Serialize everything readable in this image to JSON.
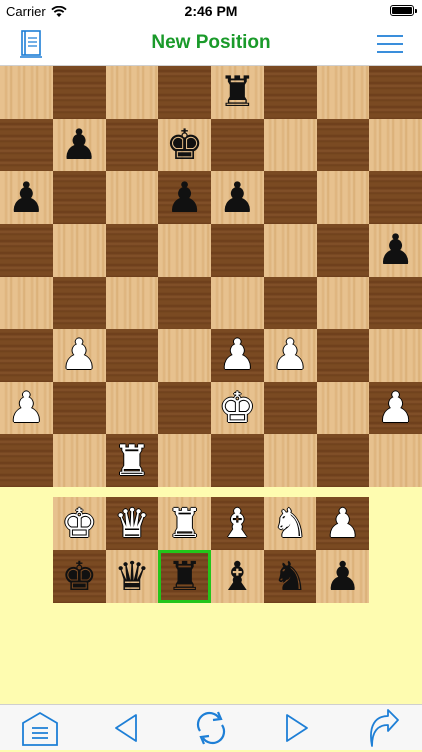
{
  "status_bar": {
    "carrier": "Carrier",
    "time": "2:46 PM"
  },
  "nav": {
    "title": "New Position",
    "title_color": "#1a9a2a",
    "accent": "#1e7fd6",
    "left_icon": "book-icon",
    "right_icon": "menu-icon"
  },
  "board": {
    "squares": [
      [
        "",
        "",
        "",
        "",
        "br",
        "",
        "",
        ""
      ],
      [
        "",
        "bp",
        "",
        "bk",
        "",
        "",
        "",
        ""
      ],
      [
        "bp",
        "",
        "",
        "bp",
        "bp",
        "",
        "",
        ""
      ],
      [
        "",
        "",
        "",
        "",
        "",
        "",
        "",
        "bp"
      ],
      [
        "",
        "",
        "",
        "",
        "",
        "",
        "",
        ""
      ],
      [
        "",
        "wp",
        "",
        "",
        "wp",
        "wp",
        "",
        ""
      ],
      [
        "wp",
        "",
        "",
        "",
        "wk",
        "",
        "",
        "wp"
      ],
      [
        "",
        "",
        "wr",
        "",
        "",
        "",
        "",
        ""
      ]
    ]
  },
  "palette": {
    "rows": [
      [
        "wk",
        "wq",
        "wr",
        "wb",
        "wn",
        "wp"
      ],
      [
        "bk",
        "bq",
        "br",
        "bb",
        "bn",
        "bp"
      ]
    ],
    "selected": "br"
  },
  "toolbar": {
    "items": [
      "home-icon",
      "back-arrow-icon",
      "rotate-icon",
      "forward-arrow-icon",
      "share-icon"
    ]
  }
}
